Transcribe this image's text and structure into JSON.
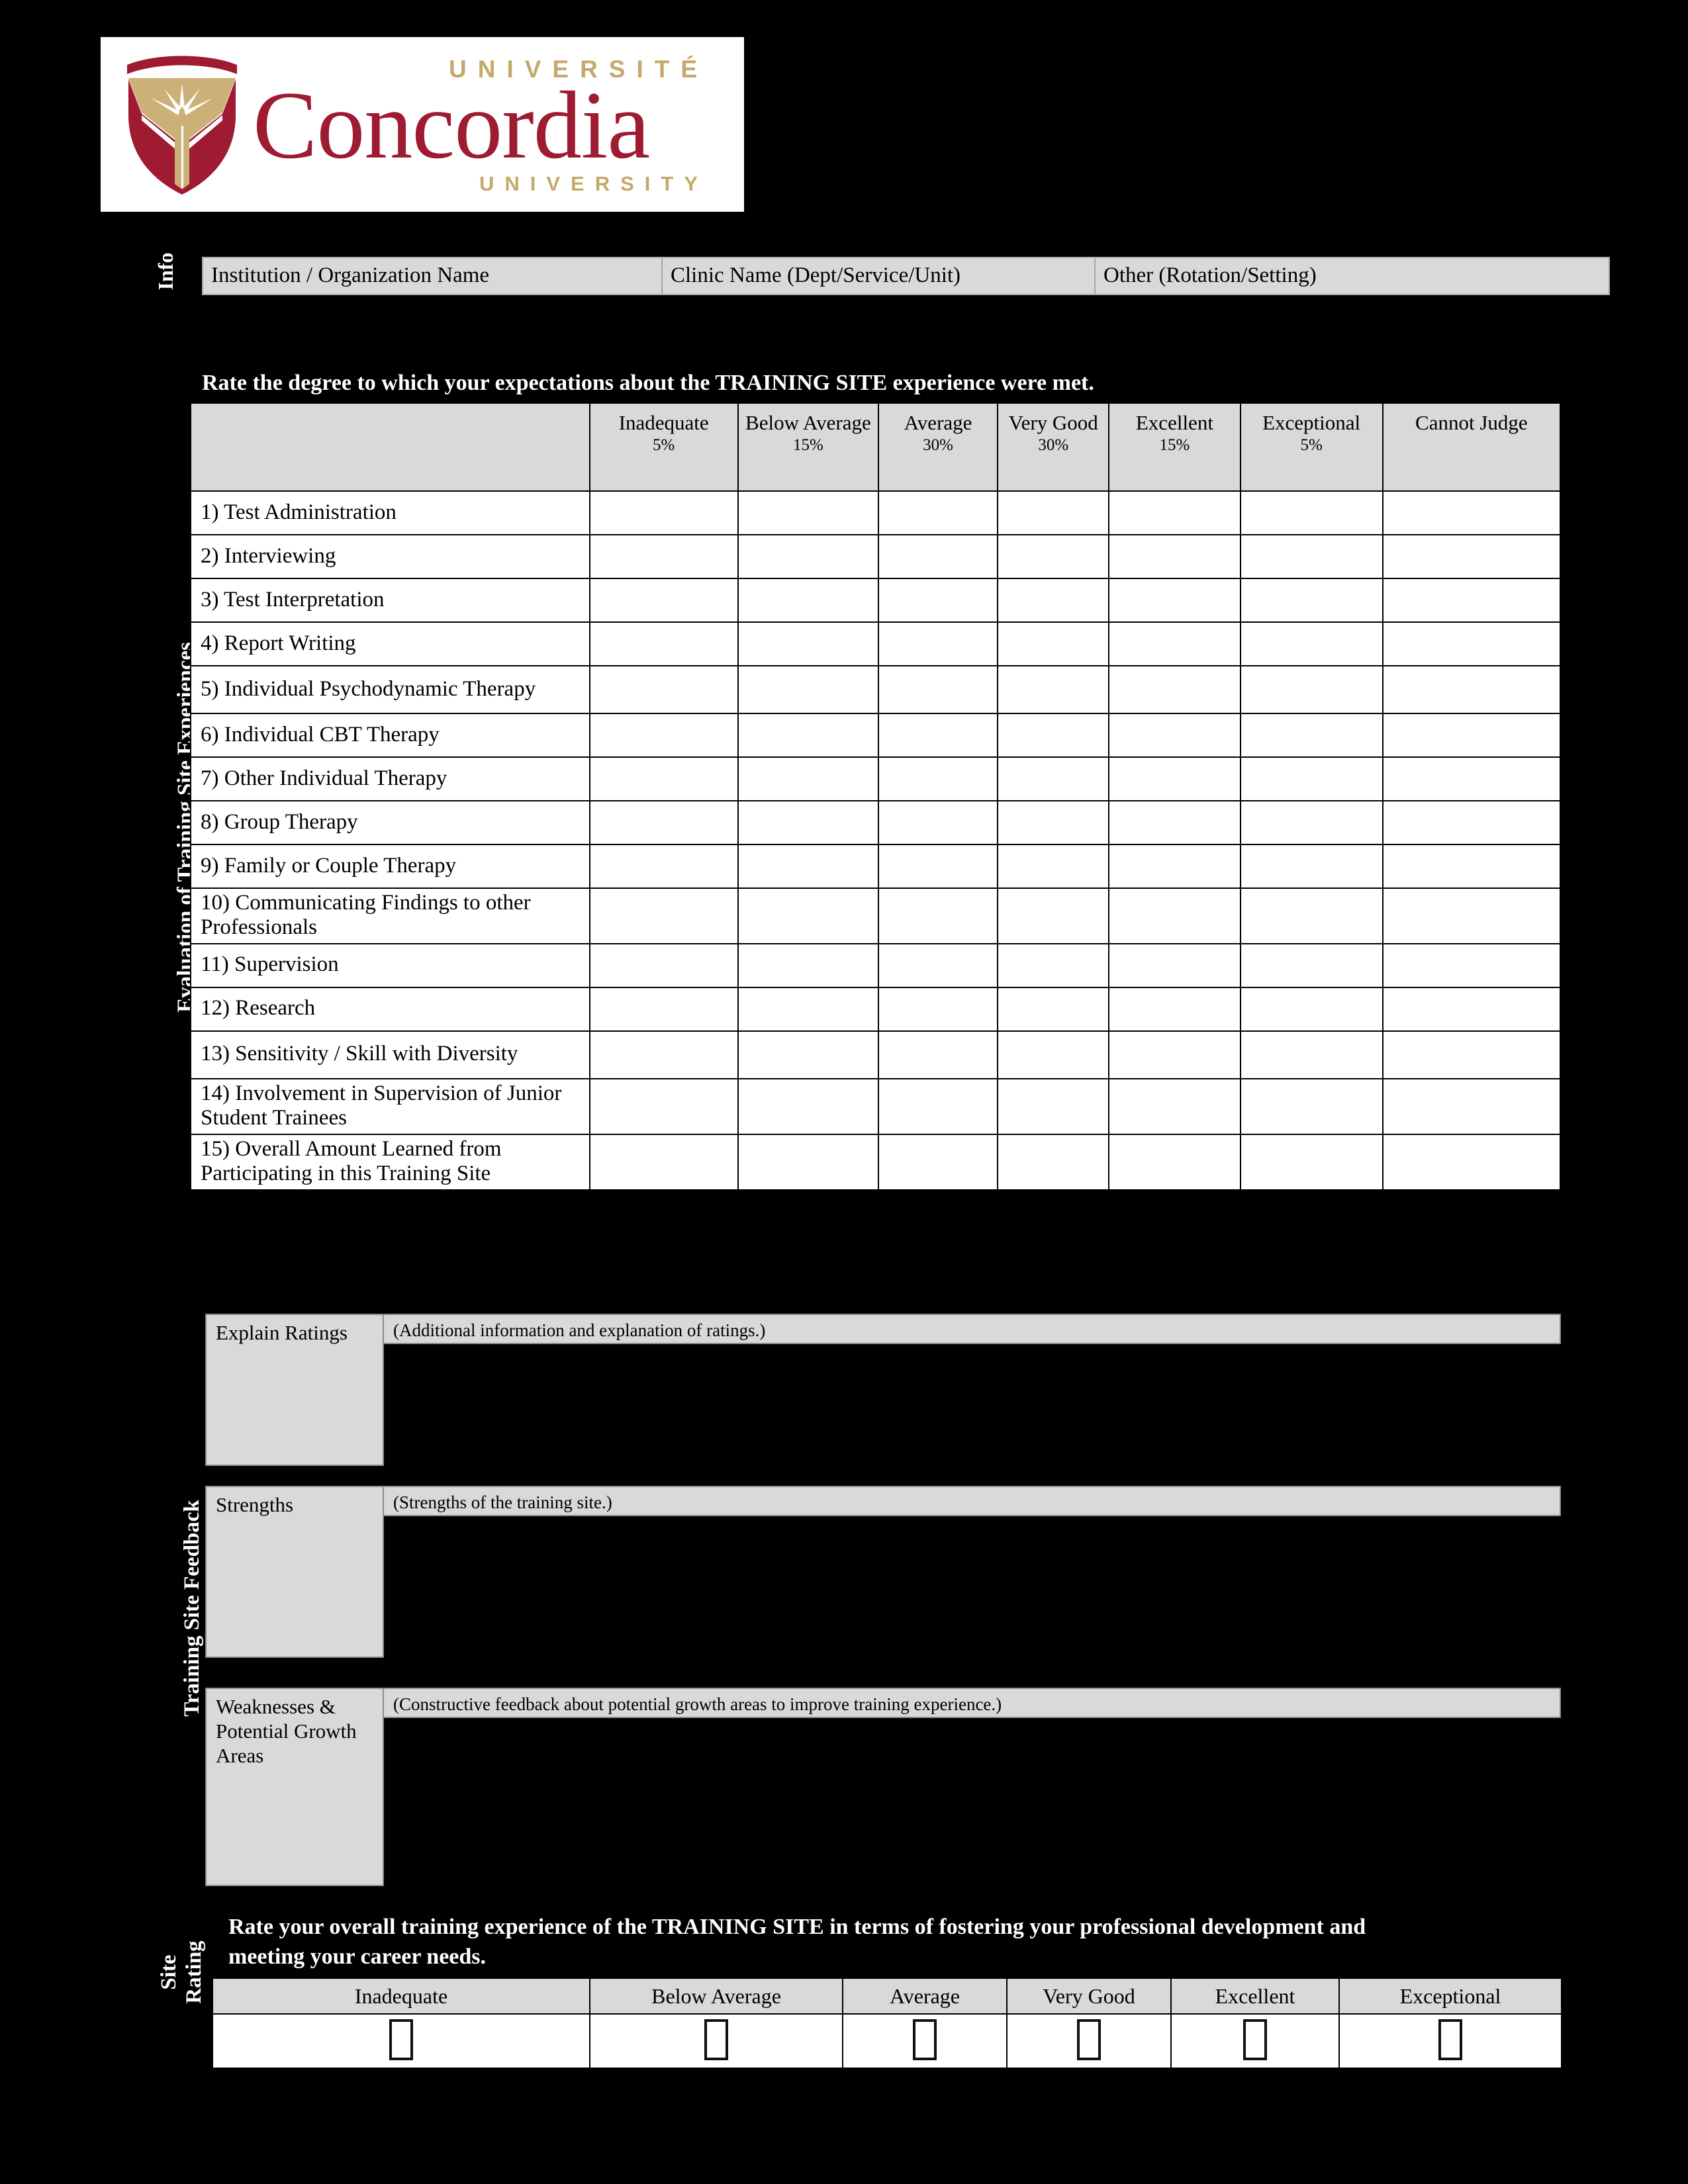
{
  "logo": {
    "top_text": "UNIVERSITÉ",
    "wordmark": "Concordia",
    "bottom_text": "UNIVERSITY",
    "colors": {
      "maroon": "#9e1b32",
      "gold": "#c5a96a"
    }
  },
  "side_labels": {
    "info": "Info",
    "evaluation": "Evaluation of Training Site Experiences",
    "feedback": "Training Site Feedback",
    "site_rating_line1": "Site",
    "site_rating_line2": "Rating"
  },
  "info_bar": {
    "fields": [
      "Institution / Organization Name",
      "Clinic Name (Dept/Service/Unit)",
      "Other (Rotation/Setting)"
    ]
  },
  "main_table": {
    "instruction": "Rate the degree to which your expectations about the TRAINING SITE experience were met.",
    "corner_label": "",
    "columns": [
      {
        "label": "Inadequate",
        "pct": "5%"
      },
      {
        "label": "Below Average",
        "pct": "15%"
      },
      {
        "label": "Average",
        "pct": "30%"
      },
      {
        "label": "Very Good",
        "pct": "30%"
      },
      {
        "label": "Excellent",
        "pct": "15%"
      },
      {
        "label": "Exceptional",
        "pct": "5%"
      },
      {
        "label": "Cannot Judge",
        "pct": ""
      }
    ],
    "rows": [
      "1) Test Administration",
      "2) Interviewing",
      "3) Test Interpretation",
      "4) Report Writing",
      "5) Individual Psychodynamic Therapy",
      "6) Individual CBT Therapy",
      "7) Other Individual Therapy",
      "8) Group Therapy",
      "9) Family or Couple Therapy",
      "10) Communicating Findings to other Professionals",
      "11) Supervision",
      "12) Research",
      "13) Sensitivity / Skill with Diversity",
      "14) Involvement in Supervision of Junior Student Trainees",
      "15) Overall Amount Learned from Participating in this Training Site"
    ]
  },
  "feedback": {
    "blocks": [
      {
        "label": "Explain Ratings",
        "prompt": "(Additional information and explanation of ratings.)",
        "value": ""
      },
      {
        "label": "Strengths",
        "prompt": "(Strengths of the training site.)",
        "value": ""
      },
      {
        "label": "Weaknesses & Potential Growth Areas",
        "prompt": "(Constructive feedback about potential growth areas to improve training experience.)",
        "value": ""
      }
    ]
  },
  "site_rating": {
    "instruction": "Rate your overall training experience of the TRAINING SITE in terms of fostering your professional development and meeting your career needs.",
    "options": [
      "Inadequate",
      "Below Average",
      "Average",
      "Very Good",
      "Excellent",
      "Exceptional"
    ],
    "checked_index": -1
  }
}
